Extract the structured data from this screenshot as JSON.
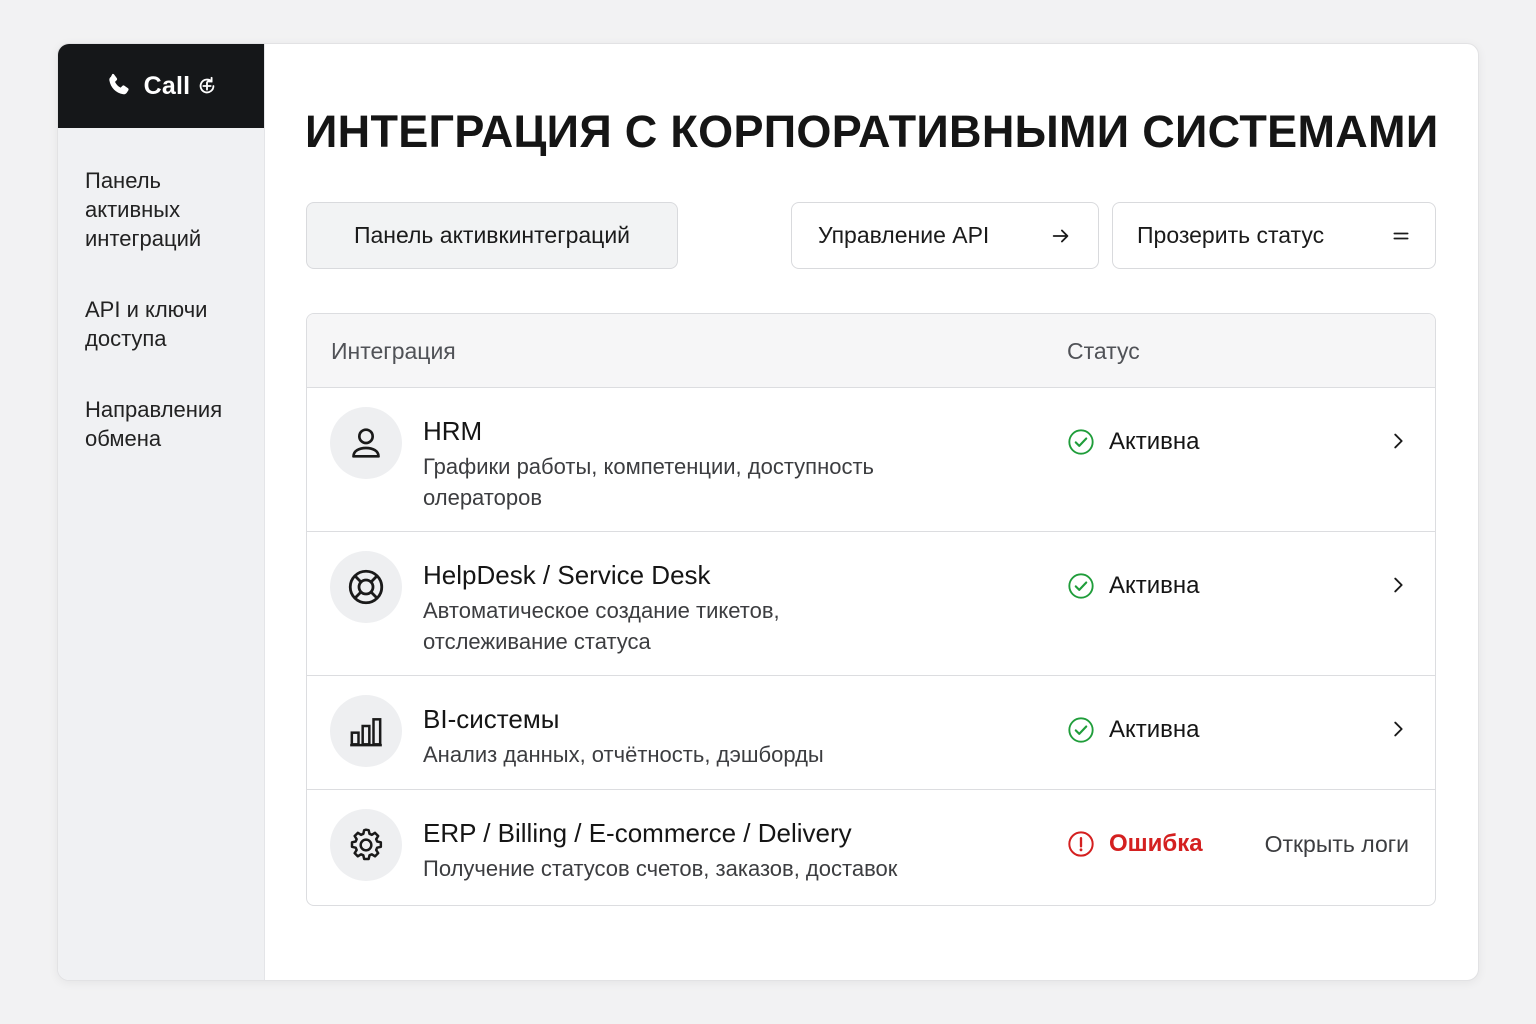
{
  "app": {
    "logo_text": "Call"
  },
  "sidebar": {
    "items": [
      {
        "label": "Панель активных интеграций"
      },
      {
        "label": "API и ключи доступа"
      },
      {
        "label": "Направления обмена"
      }
    ]
  },
  "page": {
    "title": "ИНТЕГРАЦИЯ С КОРПОРАТИВНЫМИ СИСТЕМАМИ"
  },
  "toolbar": {
    "panel_label": "Панель активкинтеграций",
    "api_label": "Управление API",
    "status_label": "Прозерить статус"
  },
  "table": {
    "headers": {
      "integration": "Интеграция",
      "status": "Статус"
    },
    "rows": [
      {
        "title": "HRM",
        "desc": "Графики работы, компетенции, доступность олераторов",
        "status": "Активна",
        "icon": "user-icon"
      },
      {
        "title": "HelpDesk / Service Desk",
        "desc": "Автоматическое создание тикетов, отслеживание статуса",
        "status": "Активна",
        "icon": "lifebuoy-icon"
      },
      {
        "title": "BI-системы",
        "desc": "Анализ данных, отчётность, дэшборды",
        "status": "Активна",
        "icon": "bar-chart-icon"
      },
      {
        "title": "ERP / Billing / E-commerce / Delivery",
        "desc": "Получение статусов счетов, заказов, доставок",
        "status": "Ошибка",
        "action": "Открыть логи",
        "icon": "gear-icon"
      }
    ]
  },
  "colors": {
    "active": "#1f9d3a",
    "error": "#d42020",
    "brand_bg": "#151719"
  }
}
